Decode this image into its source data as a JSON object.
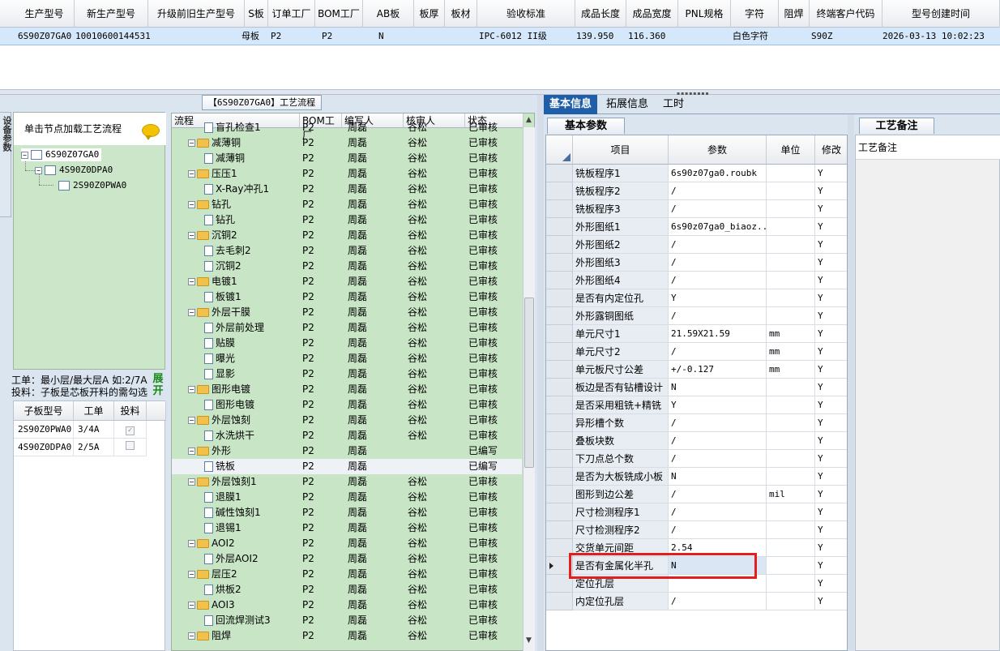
{
  "top_grid": {
    "columns": [
      "生产型号",
      "新生产型号",
      "升级前旧生产型号",
      "S板",
      "订单工厂",
      "BOM工厂",
      "AB板",
      "板厚",
      "板材",
      "验收标准",
      "成品长度",
      "成品宽度",
      "PNL规格",
      "字符",
      "阻焊",
      "终端客户代码",
      "型号创建时间"
    ],
    "row": [
      "6S90Z07GA0",
      "10010600144531",
      "母板",
      "P2",
      "P2",
      "N",
      "IPC-6012 II级",
      "139.950",
      "116.360",
      "白色字符",
      "S90Z",
      "2026-03-13 10:02:23"
    ]
  },
  "left": {
    "vertical_tab": "设备参数",
    "tree_hint": "单击节点加载工艺流程",
    "tree": [
      "6S90Z07GA0",
      "4S90Z0DPA0",
      "2S90Z0PWA0"
    ],
    "legend_line1": "工单：最小层/最大层A 如:2/7A",
    "legend_line2": "投料：子板是芯板开料的需勾选",
    "expand_button": "展开",
    "subgrid_headers": [
      "子板型号",
      "工单",
      "投料"
    ],
    "subgrid_rows": [
      {
        "model": "2S90Z0PWA0",
        "order": "3/4A",
        "checked": "✓"
      },
      {
        "model": "4S90Z0DPA0",
        "order": "2/5A",
        "checked": ""
      }
    ]
  },
  "middle": {
    "title": "【6S90Z07GA0】工艺流程",
    "headers": [
      "流程",
      "BOM工厂",
      "编写人",
      "核审人",
      "状态"
    ],
    "rows": [
      {
        "level": 2,
        "name": "盲孔检查1",
        "bom": "P2",
        "writer": "周磊",
        "checker": "谷松",
        "status": "已审核"
      },
      {
        "level": 1,
        "name": "减薄铜",
        "bom": "P2",
        "writer": "周磊",
        "checker": "谷松",
        "status": "已审核"
      },
      {
        "level": 2,
        "name": "减薄铜",
        "bom": "P2",
        "writer": "周磊",
        "checker": "谷松",
        "status": "已审核"
      },
      {
        "level": 1,
        "name": "压压1",
        "bom": "P2",
        "writer": "周磊",
        "checker": "谷松",
        "status": "已审核"
      },
      {
        "level": 2,
        "name": "X-Ray冲孔1",
        "bom": "P2",
        "writer": "周磊",
        "checker": "谷松",
        "status": "已审核"
      },
      {
        "level": 1,
        "name": "钻孔",
        "bom": "P2",
        "writer": "周磊",
        "checker": "谷松",
        "status": "已审核"
      },
      {
        "level": 2,
        "name": "钻孔",
        "bom": "P2",
        "writer": "周磊",
        "checker": "谷松",
        "status": "已审核"
      },
      {
        "level": 1,
        "name": "沉铜2",
        "bom": "P2",
        "writer": "周磊",
        "checker": "谷松",
        "status": "已审核"
      },
      {
        "level": 2,
        "name": "去毛刺2",
        "bom": "P2",
        "writer": "周磊",
        "checker": "谷松",
        "status": "已审核"
      },
      {
        "level": 2,
        "name": "沉铜2",
        "bom": "P2",
        "writer": "周磊",
        "checker": "谷松",
        "status": "已审核"
      },
      {
        "level": 1,
        "name": "电镀1",
        "bom": "P2",
        "writer": "周磊",
        "checker": "谷松",
        "status": "已审核"
      },
      {
        "level": 2,
        "name": "板镀1",
        "bom": "P2",
        "writer": "周磊",
        "checker": "谷松",
        "status": "已审核"
      },
      {
        "level": 1,
        "name": "外层干膜",
        "bom": "P2",
        "writer": "周磊",
        "checker": "谷松",
        "status": "已审核"
      },
      {
        "level": 2,
        "name": "外层前处理",
        "bom": "P2",
        "writer": "周磊",
        "checker": "谷松",
        "status": "已审核"
      },
      {
        "level": 2,
        "name": "贴膜",
        "bom": "P2",
        "writer": "周磊",
        "checker": "谷松",
        "status": "已审核"
      },
      {
        "level": 2,
        "name": "曝光",
        "bom": "P2",
        "writer": "周磊",
        "checker": "谷松",
        "status": "已审核"
      },
      {
        "level": 2,
        "name": "显影",
        "bom": "P2",
        "writer": "周磊",
        "checker": "谷松",
        "status": "已审核"
      },
      {
        "level": 1,
        "name": "图形电镀",
        "bom": "P2",
        "writer": "周磊",
        "checker": "谷松",
        "status": "已审核"
      },
      {
        "level": 2,
        "name": "图形电镀",
        "bom": "P2",
        "writer": "周磊",
        "checker": "谷松",
        "status": "已审核"
      },
      {
        "level": 1,
        "name": "外层蚀刻",
        "bom": "P2",
        "writer": "周磊",
        "checker": "谷松",
        "status": "已审核"
      },
      {
        "level": 2,
        "name": "水洗烘干",
        "bom": "P2",
        "writer": "周磊",
        "checker": "谷松",
        "status": "已审核"
      },
      {
        "level": 1,
        "name": "外形",
        "bom": "P2",
        "writer": "周磊",
        "checker": "",
        "status": "已编写"
      },
      {
        "level": 2,
        "name": "铣板",
        "bom": "P2",
        "writer": "周磊",
        "checker": "",
        "status": "已编写",
        "selected": true
      },
      {
        "level": 1,
        "name": "外层蚀刻1",
        "bom": "P2",
        "writer": "周磊",
        "checker": "谷松",
        "status": "已审核"
      },
      {
        "level": 2,
        "name": "退膜1",
        "bom": "P2",
        "writer": "周磊",
        "checker": "谷松",
        "status": "已审核"
      },
      {
        "level": 2,
        "name": "碱性蚀刻1",
        "bom": "P2",
        "writer": "周磊",
        "checker": "谷松",
        "status": "已审核"
      },
      {
        "level": 2,
        "name": "退锡1",
        "bom": "P2",
        "writer": "周磊",
        "checker": "谷松",
        "status": "已审核"
      },
      {
        "level": 1,
        "name": "AOI2",
        "bom": "P2",
        "writer": "周磊",
        "checker": "谷松",
        "status": "已审核"
      },
      {
        "level": 2,
        "name": "外层AOI2",
        "bom": "P2",
        "writer": "周磊",
        "checker": "谷松",
        "status": "已审核"
      },
      {
        "level": 1,
        "name": "层压2",
        "bom": "P2",
        "writer": "周磊",
        "checker": "谷松",
        "status": "已审核"
      },
      {
        "level": 2,
        "name": "烘板2",
        "bom": "P2",
        "writer": "周磊",
        "checker": "谷松",
        "status": "已审核"
      },
      {
        "level": 1,
        "name": "AOI3",
        "bom": "P2",
        "writer": "周磊",
        "checker": "谷松",
        "status": "已审核"
      },
      {
        "level": 2,
        "name": "回流焊测试3",
        "bom": "P2",
        "writer": "周磊",
        "checker": "谷松",
        "status": "已审核"
      },
      {
        "level": 1,
        "name": "阻焊",
        "bom": "P2",
        "writer": "周磊",
        "checker": "谷松",
        "status": "已审核"
      }
    ]
  },
  "right": {
    "tabs": [
      "基本信息",
      "拓展信息",
      "工时"
    ],
    "subtab": "基本参数",
    "headers": [
      "项目",
      "参数",
      "单位",
      "修改"
    ],
    "rows": [
      {
        "item": "铣板程序1",
        "param": "6s90z07ga0.roubk",
        "unit": "",
        "mod": "Y"
      },
      {
        "item": "铣板程序2",
        "param": "/",
        "unit": "",
        "mod": "Y"
      },
      {
        "item": "铣板程序3",
        "param": "/",
        "unit": "",
        "mod": "Y"
      },
      {
        "item": "外形图纸1",
        "param": "6s90z07ga0_biaoz...",
        "unit": "",
        "mod": "Y"
      },
      {
        "item": "外形图纸2",
        "param": "/",
        "unit": "",
        "mod": "Y"
      },
      {
        "item": "外形图纸3",
        "param": "/",
        "unit": "",
        "mod": "Y"
      },
      {
        "item": "外形图纸4",
        "param": "/",
        "unit": "",
        "mod": "Y"
      },
      {
        "item": "是否有内定位孔",
        "param": "Y",
        "unit": "",
        "mod": "Y"
      },
      {
        "item": "外形露铜图纸",
        "param": "/",
        "unit": "",
        "mod": "Y"
      },
      {
        "item": "单元尺寸1",
        "param": "21.59X21.59",
        "unit": "mm",
        "mod": "Y"
      },
      {
        "item": "单元尺寸2",
        "param": "/",
        "unit": "mm",
        "mod": "Y"
      },
      {
        "item": "单元板尺寸公差",
        "param": "+/-0.127",
        "unit": "mm",
        "mod": "Y"
      },
      {
        "item": "板边是否有钻槽设计",
        "param": "N",
        "unit": "",
        "mod": "Y"
      },
      {
        "item": "是否采用粗铣+精铣",
        "param": "Y",
        "unit": "",
        "mod": "Y"
      },
      {
        "item": "异形槽个数",
        "param": "/",
        "unit": "",
        "mod": "Y"
      },
      {
        "item": "叠板块数",
        "param": "/",
        "unit": "",
        "mod": "Y"
      },
      {
        "item": "下刀点总个数",
        "param": "/",
        "unit": "",
        "mod": "Y"
      },
      {
        "item": "是否为大板铣成小板",
        "param": "N",
        "unit": "",
        "mod": "Y"
      },
      {
        "item": "图形到边公差",
        "param": "/",
        "unit": "mil",
        "mod": "Y"
      },
      {
        "item": "尺寸检测程序1",
        "param": "/",
        "unit": "",
        "mod": "Y"
      },
      {
        "item": "尺寸检测程序2",
        "param": "/",
        "unit": "",
        "mod": "Y"
      },
      {
        "item": "交货单元间距",
        "param": "2.54",
        "unit": "",
        "mod": "Y"
      },
      {
        "item": "是否有金属化半孔",
        "param": "N",
        "unit": "",
        "mod": "Y",
        "current": true
      },
      {
        "item": "定位孔层",
        "param": "",
        "unit": "",
        "mod": "Y"
      },
      {
        "item": "内定位孔层",
        "param": "/",
        "unit": "",
        "mod": "Y"
      }
    ],
    "notes_tab": "工艺备注",
    "notes_header": "工艺备注"
  }
}
